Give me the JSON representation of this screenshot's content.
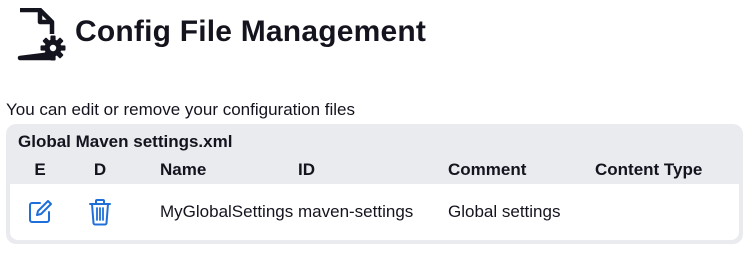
{
  "header": {
    "icon": "config-file-gear-icon",
    "title": "Config File Management"
  },
  "description": "You can edit or remove your configuration files",
  "panel": {
    "title": "Global Maven settings.xml",
    "columns": {
      "edit": "E",
      "delete": "D",
      "name": "Name",
      "id": "ID",
      "comment": "Comment",
      "content_type": "Content Type"
    },
    "rows": [
      {
        "edit_icon": "edit-icon",
        "delete_icon": "trash-icon",
        "name": "MyGlobalSettings",
        "id": "maven-settings",
        "comment": "Global settings",
        "content_type": ""
      }
    ]
  },
  "colors": {
    "text": "#14141f",
    "accent": "#1e6fd9",
    "panel_background": "#e9ebef"
  }
}
